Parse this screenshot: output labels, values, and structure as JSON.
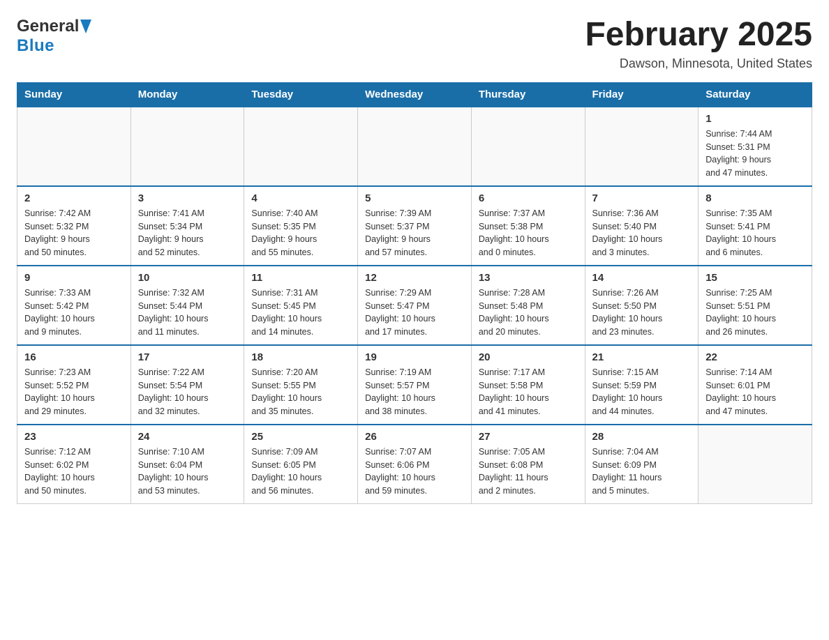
{
  "header": {
    "logo": {
      "general": "General",
      "blue": "Blue"
    },
    "title": "February 2025",
    "location": "Dawson, Minnesota, United States"
  },
  "calendar": {
    "days_of_week": [
      "Sunday",
      "Monday",
      "Tuesday",
      "Wednesday",
      "Thursday",
      "Friday",
      "Saturday"
    ],
    "weeks": [
      [
        {
          "day": "",
          "info": ""
        },
        {
          "day": "",
          "info": ""
        },
        {
          "day": "",
          "info": ""
        },
        {
          "day": "",
          "info": ""
        },
        {
          "day": "",
          "info": ""
        },
        {
          "day": "",
          "info": ""
        },
        {
          "day": "1",
          "info": "Sunrise: 7:44 AM\nSunset: 5:31 PM\nDaylight: 9 hours\nand 47 minutes."
        }
      ],
      [
        {
          "day": "2",
          "info": "Sunrise: 7:42 AM\nSunset: 5:32 PM\nDaylight: 9 hours\nand 50 minutes."
        },
        {
          "day": "3",
          "info": "Sunrise: 7:41 AM\nSunset: 5:34 PM\nDaylight: 9 hours\nand 52 minutes."
        },
        {
          "day": "4",
          "info": "Sunrise: 7:40 AM\nSunset: 5:35 PM\nDaylight: 9 hours\nand 55 minutes."
        },
        {
          "day": "5",
          "info": "Sunrise: 7:39 AM\nSunset: 5:37 PM\nDaylight: 9 hours\nand 57 minutes."
        },
        {
          "day": "6",
          "info": "Sunrise: 7:37 AM\nSunset: 5:38 PM\nDaylight: 10 hours\nand 0 minutes."
        },
        {
          "day": "7",
          "info": "Sunrise: 7:36 AM\nSunset: 5:40 PM\nDaylight: 10 hours\nand 3 minutes."
        },
        {
          "day": "8",
          "info": "Sunrise: 7:35 AM\nSunset: 5:41 PM\nDaylight: 10 hours\nand 6 minutes."
        }
      ],
      [
        {
          "day": "9",
          "info": "Sunrise: 7:33 AM\nSunset: 5:42 PM\nDaylight: 10 hours\nand 9 minutes."
        },
        {
          "day": "10",
          "info": "Sunrise: 7:32 AM\nSunset: 5:44 PM\nDaylight: 10 hours\nand 11 minutes."
        },
        {
          "day": "11",
          "info": "Sunrise: 7:31 AM\nSunset: 5:45 PM\nDaylight: 10 hours\nand 14 minutes."
        },
        {
          "day": "12",
          "info": "Sunrise: 7:29 AM\nSunset: 5:47 PM\nDaylight: 10 hours\nand 17 minutes."
        },
        {
          "day": "13",
          "info": "Sunrise: 7:28 AM\nSunset: 5:48 PM\nDaylight: 10 hours\nand 20 minutes."
        },
        {
          "day": "14",
          "info": "Sunrise: 7:26 AM\nSunset: 5:50 PM\nDaylight: 10 hours\nand 23 minutes."
        },
        {
          "day": "15",
          "info": "Sunrise: 7:25 AM\nSunset: 5:51 PM\nDaylight: 10 hours\nand 26 minutes."
        }
      ],
      [
        {
          "day": "16",
          "info": "Sunrise: 7:23 AM\nSunset: 5:52 PM\nDaylight: 10 hours\nand 29 minutes."
        },
        {
          "day": "17",
          "info": "Sunrise: 7:22 AM\nSunset: 5:54 PM\nDaylight: 10 hours\nand 32 minutes."
        },
        {
          "day": "18",
          "info": "Sunrise: 7:20 AM\nSunset: 5:55 PM\nDaylight: 10 hours\nand 35 minutes."
        },
        {
          "day": "19",
          "info": "Sunrise: 7:19 AM\nSunset: 5:57 PM\nDaylight: 10 hours\nand 38 minutes."
        },
        {
          "day": "20",
          "info": "Sunrise: 7:17 AM\nSunset: 5:58 PM\nDaylight: 10 hours\nand 41 minutes."
        },
        {
          "day": "21",
          "info": "Sunrise: 7:15 AM\nSunset: 5:59 PM\nDaylight: 10 hours\nand 44 minutes."
        },
        {
          "day": "22",
          "info": "Sunrise: 7:14 AM\nSunset: 6:01 PM\nDaylight: 10 hours\nand 47 minutes."
        }
      ],
      [
        {
          "day": "23",
          "info": "Sunrise: 7:12 AM\nSunset: 6:02 PM\nDaylight: 10 hours\nand 50 minutes."
        },
        {
          "day": "24",
          "info": "Sunrise: 7:10 AM\nSunset: 6:04 PM\nDaylight: 10 hours\nand 53 minutes."
        },
        {
          "day": "25",
          "info": "Sunrise: 7:09 AM\nSunset: 6:05 PM\nDaylight: 10 hours\nand 56 minutes."
        },
        {
          "day": "26",
          "info": "Sunrise: 7:07 AM\nSunset: 6:06 PM\nDaylight: 10 hours\nand 59 minutes."
        },
        {
          "day": "27",
          "info": "Sunrise: 7:05 AM\nSunset: 6:08 PM\nDaylight: 11 hours\nand 2 minutes."
        },
        {
          "day": "28",
          "info": "Sunrise: 7:04 AM\nSunset: 6:09 PM\nDaylight: 11 hours\nand 5 minutes."
        },
        {
          "day": "",
          "info": ""
        }
      ]
    ]
  }
}
